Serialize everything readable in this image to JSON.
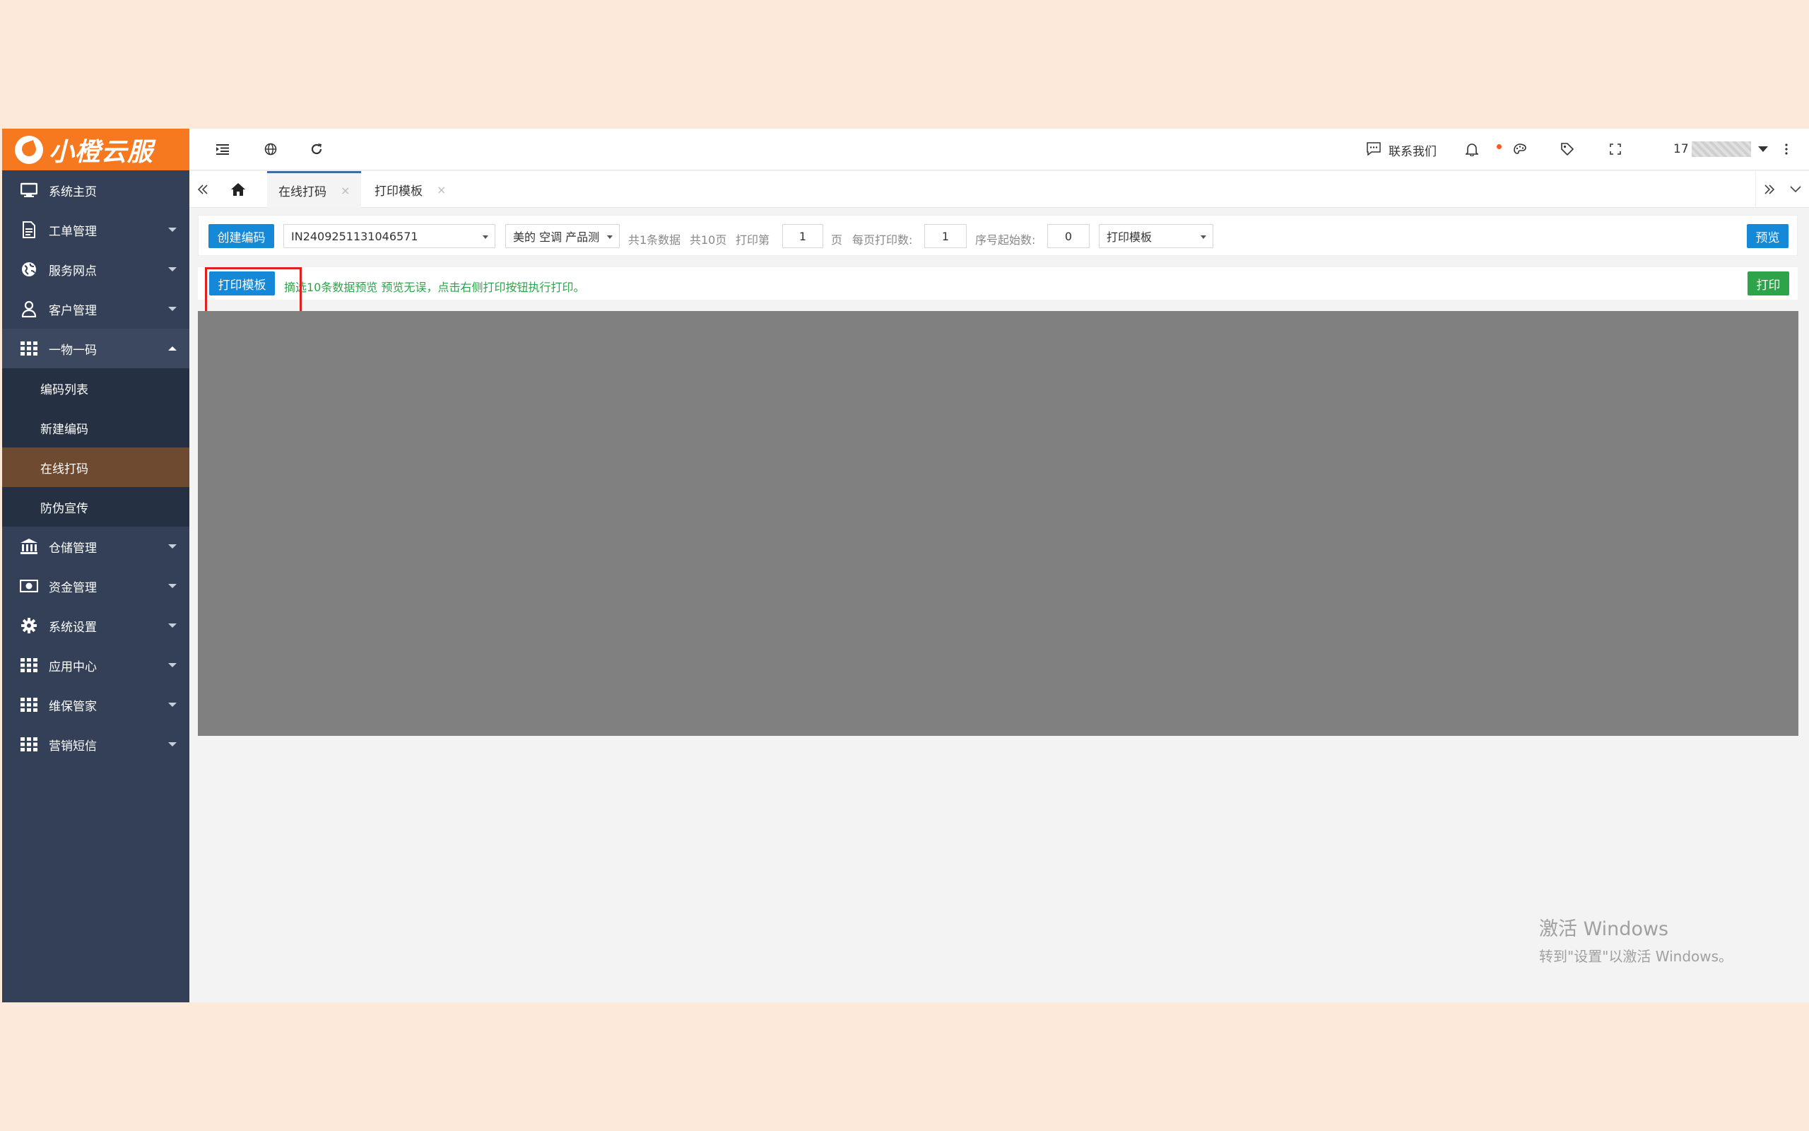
{
  "app": {
    "logo_text": "小橙云服"
  },
  "sidebar": {
    "items": [
      {
        "label": "系统主页",
        "icon": "monitor-icon",
        "has_caret": false
      },
      {
        "label": "工单管理",
        "icon": "document-icon",
        "has_caret": true
      },
      {
        "label": "服务网点",
        "icon": "globe-icon",
        "has_caret": true
      },
      {
        "label": "客户管理",
        "icon": "user-icon",
        "has_caret": true
      },
      {
        "label": "一物一码",
        "icon": "grid-icon",
        "has_caret": true,
        "open": true
      }
    ],
    "sub_items": [
      {
        "label": "编码列表"
      },
      {
        "label": "新建编码"
      },
      {
        "label": "在线打码",
        "active": true
      },
      {
        "label": "防伪宣传"
      }
    ],
    "items_after": [
      {
        "label": "仓储管理",
        "icon": "bank-icon"
      },
      {
        "label": "资金管理",
        "icon": "money-icon"
      },
      {
        "label": "系统设置",
        "icon": "gear-icon"
      },
      {
        "label": "应用中心",
        "icon": "grid-icon"
      },
      {
        "label": "维保管家",
        "icon": "grid-icon"
      },
      {
        "label": "营销短信",
        "icon": "grid-icon"
      }
    ]
  },
  "header": {
    "contact_label": "联系我们",
    "user_prefix": "17"
  },
  "tabs": [
    {
      "label": "在线打码",
      "active": true
    },
    {
      "label": "打印模板",
      "active": false
    }
  ],
  "toolbar": {
    "create_button": "创建编码",
    "code_select": "IN2409251131046571",
    "product_select": "美的 空调 产品测",
    "total_records": "共1条数据",
    "total_pages": "共10页",
    "print_page_prefix": "打印第",
    "print_page_value": "1",
    "print_page_suffix": "页",
    "per_page_label": "每页打印数:",
    "per_page_value": "1",
    "seq_start_label": "序号起始数:",
    "seq_start_value": "0",
    "template_select": "打印模板",
    "preview_button": "预览"
  },
  "toolbar2": {
    "template_button": "打印模板",
    "hint": "摘选10条数据预览 预览无误，点击右侧打印按钮执行打印。",
    "print_button": "打印"
  },
  "watermark": {
    "line1": "激活 Windows",
    "line2": "转到\"设置\"以激活 Windows。"
  }
}
